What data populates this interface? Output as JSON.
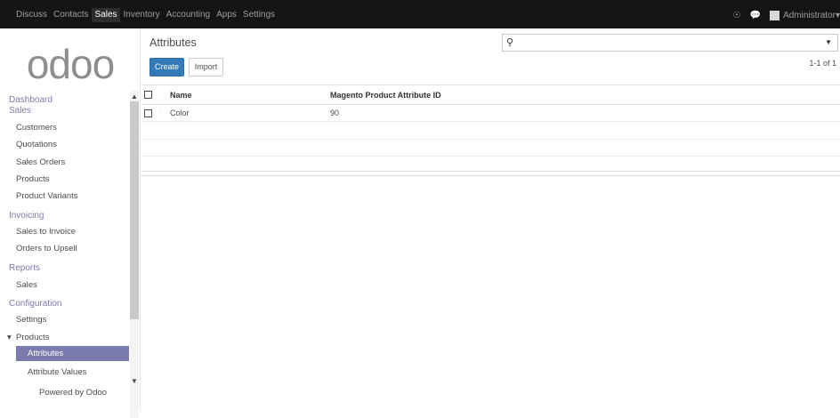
{
  "topbar": {
    "nav": [
      "Discuss",
      "Contacts",
      "Sales",
      "Inventory",
      "Accounting",
      "Apps",
      "Settings"
    ],
    "active": "Sales",
    "user": "Administrator",
    "icons": [
      "help-icon",
      "chat-icon",
      "user-avatar-icon"
    ]
  },
  "sidebar": {
    "logo": "odoo",
    "sections": [
      {
        "title": "Dashboard"
      },
      {
        "title": "Sales",
        "items": [
          "Customers",
          "Quotations",
          "Sales Orders",
          "Products",
          "Product Variants"
        ]
      },
      {
        "title": "Invoicing",
        "items": [
          "Sales to Invoice",
          "Orders to Upsell"
        ]
      },
      {
        "title": "Reports",
        "items": [
          "Sales"
        ]
      },
      {
        "title": "Configuration",
        "items": [
          "Settings",
          "Products"
        ]
      }
    ],
    "product_submenu": [
      "Attributes",
      "Attribute Values"
    ],
    "active_item": "Attributes",
    "footer": "Powered by Odoo"
  },
  "control_panel": {
    "title": "Attributes",
    "create_label": "Create",
    "import_label": "Import",
    "pager": "1-1 of 1",
    "search_value": ""
  },
  "list": {
    "columns": [
      "Name",
      "Magento Product Attribute ID"
    ],
    "rows": [
      {
        "name": "Color",
        "magento_id": "90"
      }
    ]
  },
  "colors": {
    "topbar_bg": "#141414",
    "accent": "#7c7bad",
    "primary_button": "#337ab7"
  }
}
